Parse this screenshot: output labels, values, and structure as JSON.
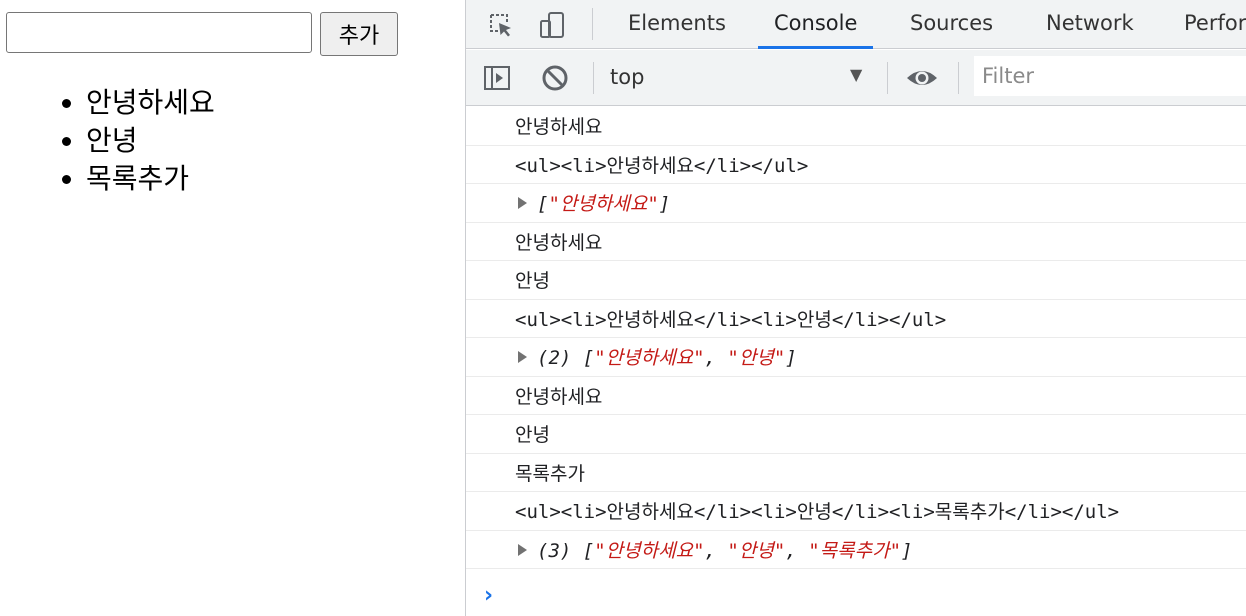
{
  "page": {
    "input_value": "",
    "add_button_label": "추가",
    "list_items": [
      "안녕하세요",
      "안녕",
      "목록추가"
    ]
  },
  "devtools": {
    "tabs": [
      "Elements",
      "Console",
      "Sources",
      "Network",
      "Perfor"
    ],
    "active_tab": "Console",
    "context": "top",
    "filter_placeholder": "Filter",
    "icons": [
      "inspect-element-icon",
      "device-toolbar-icon",
      "show-sidebar-icon",
      "clear-console-icon",
      "live-expression-eye-icon"
    ],
    "accent_color": "#1a73e8",
    "string_color": "#c41a16"
  },
  "console": {
    "messages": [
      {
        "kind": "text",
        "text": "안녕하세요"
      },
      {
        "kind": "html",
        "text": "<ul><li>안녕하세요</li></ul>"
      },
      {
        "kind": "array",
        "count": "",
        "items": [
          "안녕하세요"
        ]
      },
      {
        "kind": "text",
        "text": "안녕하세요"
      },
      {
        "kind": "text",
        "text": "안녕"
      },
      {
        "kind": "html",
        "text": "<ul><li>안녕하세요</li><li>안녕</li></ul>"
      },
      {
        "kind": "array",
        "count": "(2)",
        "items": [
          "안녕하세요",
          "안녕"
        ]
      },
      {
        "kind": "text",
        "text": "안녕하세요"
      },
      {
        "kind": "text",
        "text": "안녕"
      },
      {
        "kind": "text",
        "text": "목록추가"
      },
      {
        "kind": "html",
        "text": "<ul><li>안녕하세요</li><li>안녕</li><li>목록추가</li></ul>"
      },
      {
        "kind": "array",
        "count": "(3)",
        "items": [
          "안녕하세요",
          "안녕",
          "목록추가"
        ]
      }
    ],
    "prompt_symbol": "›"
  }
}
